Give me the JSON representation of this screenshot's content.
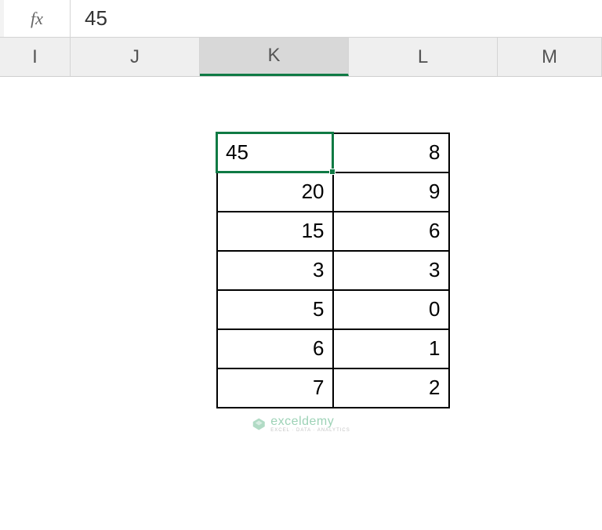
{
  "formula_bar": {
    "fx_label": "fx",
    "value": "45"
  },
  "columns": {
    "I": "I",
    "J": "J",
    "K": "K",
    "L": "L",
    "M": "M"
  },
  "table": {
    "rows": [
      {
        "k": "45",
        "l": "8"
      },
      {
        "k": "20",
        "l": "9"
      },
      {
        "k": "15",
        "l": "6"
      },
      {
        "k": "3",
        "l": "3"
      },
      {
        "k": "5",
        "l": "0"
      },
      {
        "k": "6",
        "l": "1"
      },
      {
        "k": "7",
        "l": "2"
      }
    ]
  },
  "watermark": {
    "name": "exceldemy",
    "tagline": "EXCEL · DATA · ANALYTICS"
  }
}
